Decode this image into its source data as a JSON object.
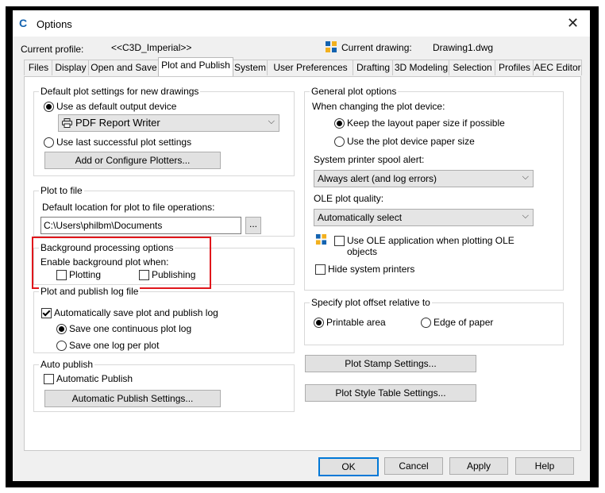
{
  "window": {
    "title": "Options",
    "close": "✕"
  },
  "profile": {
    "label": "Current profile:",
    "value": "<<C3D_Imperial>>",
    "drawing_label": "Current drawing:",
    "drawing_value": "Drawing1.dwg"
  },
  "tabs": [
    "Files",
    "Display",
    "Open and Save",
    "Plot and Publish",
    "System",
    "User Preferences",
    "Drafting",
    "3D Modeling",
    "Selection",
    "Profiles",
    "AEC Editor"
  ],
  "default_plot": {
    "title": "Default plot settings for new drawings",
    "use_default": "Use as default output device",
    "device": "PDF Report Writer",
    "use_last": "Use last successful plot settings",
    "add_button": "Add or Configure Plotters..."
  },
  "plot_to_file": {
    "title": "Plot to file",
    "location_label": "Default location for plot to file operations:",
    "path": "C:\\Users\\philbm\\Documents",
    "browse": "..."
  },
  "background": {
    "title": "Background processing options",
    "enable_label": "Enable background plot when:",
    "plotting": "Plotting",
    "publishing": "Publishing"
  },
  "log": {
    "title": "Plot and publish log file",
    "auto_save": "Automatically save plot and publish log",
    "continuous": "Save one continuous plot log",
    "per_plot": "Save one log per plot"
  },
  "auto_publish": {
    "title": "Auto publish",
    "automatic": "Automatic Publish",
    "settings_button": "Automatic Publish Settings..."
  },
  "general": {
    "title": "General plot options",
    "when_changing": "When changing the plot device:",
    "keep_layout": "Keep the layout paper size if possible",
    "use_device": "Use the plot device paper size",
    "spool_label": "System printer spool alert:",
    "spool_value": "Always alert (and log errors)",
    "ole_label": "OLE plot quality:",
    "ole_value": "Automatically select",
    "use_ole_line1": "Use OLE application when plotting OLE",
    "use_ole_line2": "objects",
    "hide_printers": "Hide system printers"
  },
  "offset": {
    "title": "Specify plot offset relative to",
    "printable": "Printable area",
    "edge": "Edge of paper"
  },
  "buttons": {
    "stamp": "Plot Stamp Settings...",
    "style_table": "Plot Style Table Settings...",
    "ok": "OK",
    "cancel": "Cancel",
    "apply": "Apply",
    "help": "Help"
  },
  "colors": {
    "highlight": "#e0161b",
    "accent": "#1463b0"
  }
}
